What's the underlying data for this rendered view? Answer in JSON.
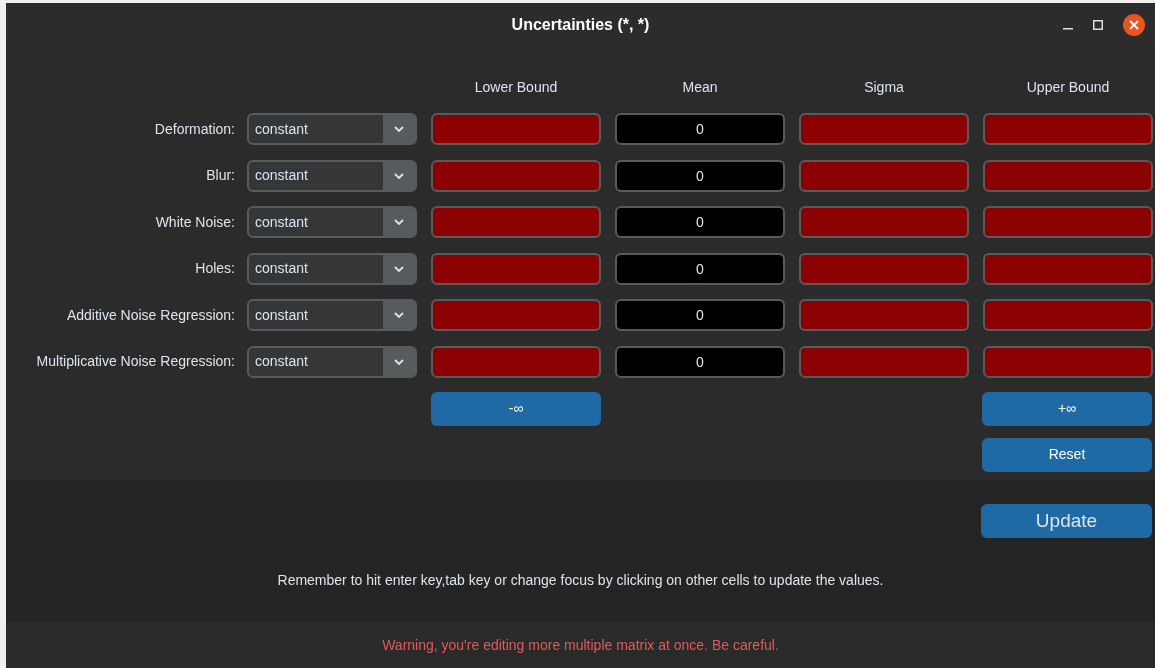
{
  "window": {
    "title": "Uncertainties (*, *)"
  },
  "columns": [
    "Lower Bound",
    "Mean",
    "Sigma",
    "Upper Bound"
  ],
  "rows": [
    {
      "label": "Deformation:",
      "distribution": "constant",
      "cells": [
        {
          "invalid": true
        },
        {
          "value": "0",
          "invalid": false
        },
        {
          "invalid": true
        },
        {
          "invalid": true
        }
      ]
    },
    {
      "label": "Blur:",
      "distribution": "constant",
      "cells": [
        {
          "invalid": true
        },
        {
          "value": "0",
          "invalid": false
        },
        {
          "invalid": true
        },
        {
          "invalid": true
        }
      ]
    },
    {
      "label": "White Noise:",
      "distribution": "constant",
      "cells": [
        {
          "invalid": true
        },
        {
          "value": "0",
          "invalid": false
        },
        {
          "invalid": true
        },
        {
          "invalid": true
        }
      ]
    },
    {
      "label": "Holes:",
      "distribution": "constant",
      "cells": [
        {
          "invalid": true
        },
        {
          "value": "0",
          "invalid": false
        },
        {
          "invalid": true
        },
        {
          "invalid": true
        }
      ]
    },
    {
      "label": "Additive Noise Regression:",
      "distribution": "constant",
      "cells": [
        {
          "invalid": true
        },
        {
          "value": "0",
          "invalid": false
        },
        {
          "invalid": true
        },
        {
          "invalid": true
        }
      ]
    },
    {
      "label": "Multiplicative Noise Regression:",
      "distribution": "constant",
      "cells": [
        {
          "invalid": true
        },
        {
          "value": "0",
          "invalid": false
        },
        {
          "invalid": true
        },
        {
          "invalid": true
        }
      ]
    }
  ],
  "minus_infinity_button": "-∞",
  "plus_infinity_button": "+∞",
  "reset_button": "Reset",
  "update_button": "Update",
  "hint": "Remember to hit enter key,tab key or change focus by clicking on other cells to update the values.",
  "warning": "Warning, you're editing more multiple matrix at once. Be careful."
}
